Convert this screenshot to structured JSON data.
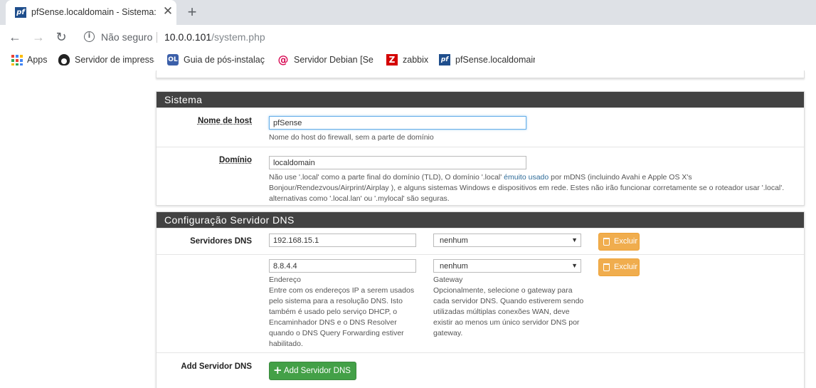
{
  "browser": {
    "tab_title": "pfSense.localdomain - Sistema: Configuração Geral",
    "tab_favicon": "pf",
    "security_text": "Não seguro",
    "url_host": "10.0.0.101",
    "url_path": "/system.php",
    "bookmarks": [
      {
        "label": "Apps",
        "icon": "apps-grid-icon"
      },
      {
        "label": "Servidor de impressão",
        "icon": "tux-icon"
      },
      {
        "label": "Guia de pós-instalação",
        "icon": "ol-icon",
        "icon_text": "OL"
      },
      {
        "label": "Servidor Debian [Servidor]",
        "icon": "debian-swirl-icon",
        "icon_text": "@"
      },
      {
        "label": "zabbix",
        "icon": "zabbix-icon",
        "icon_text": "Z"
      },
      {
        "label": "pfSense.localdomain",
        "icon": "pfsense-icon",
        "icon_text": "pf"
      }
    ]
  },
  "sistema": {
    "heading": "Sistema",
    "hostname": {
      "label": "Nome de host",
      "value": "pfSense",
      "help": "Nome do host do firewall, sem a parte de domínio"
    },
    "domain": {
      "label": "Domínio",
      "value": "localdomain",
      "help_before": "Não use '.local' como a parte final do domínio (TLD), O domínio '.local' ",
      "help_link": "émuito usado",
      "help_after": " por mDNS (incluindo Avahi e Apple OS X's Bonjour/Rendezvous/Airprint/Airplay ), e alguns sistemas Windows e dispositivos em rede. Estes não irão funcionar corretamente se o roteador usar '.local'. alternativas como '.local.lan' ou '.mylocal' são seguras."
    }
  },
  "dns": {
    "heading": "Configuração Servidor DNS",
    "servers_label": "Servidores DNS",
    "servers": [
      {
        "address": "192.168.15.1",
        "gateway": "nenhum",
        "delete_label": "Excluir"
      },
      {
        "address": "8.8.4.4",
        "gateway": "nenhum",
        "delete_label": "Excluir"
      }
    ],
    "address_label": "Endereço",
    "address_help": "Entre com os endereços IP a serem usados pelo sistema para a resolução DNS. Isto também é usado pelo serviço DHCP, o Encaminhador DNS e o DNS Resolver quando o DNS Query Forwarding estiver habilitado.",
    "gateway_label": "Gateway",
    "gateway_help": "Opcionalmente, selecione o gateway para cada servidor DNS. Quando estiverem sendo utilizadas múltiplas conexões WAN, deve existir ao menos um único servidor DNS por gateway.",
    "add_label": "Add Servidor DNS",
    "add_button": "Add Servidor DNS"
  },
  "colors": {
    "panel_header": "#424242",
    "warning": "#f0ad4e",
    "success": "#43a047",
    "link": "#2f6c99"
  }
}
